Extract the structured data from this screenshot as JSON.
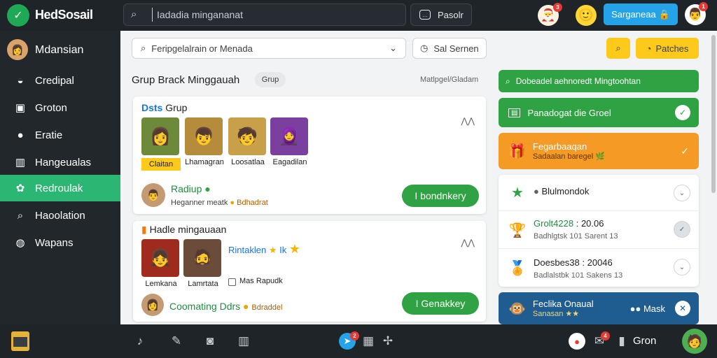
{
  "app": {
    "brand": "HedSosail"
  },
  "topbar": {
    "search_placeholder": "Iadadia mingananat",
    "button_label": "Pasolr",
    "primary_label": "Sarganeaa",
    "notif_count_1": "3",
    "notif_count_2": "1"
  },
  "sidebar": {
    "profile_name": "Mdansian",
    "items": [
      {
        "label": "Credipal",
        "icon": "chat-icon"
      },
      {
        "label": "Groton",
        "icon": "door-icon"
      },
      {
        "label": "Eratie",
        "icon": "user-icon"
      },
      {
        "label": "Hangeualas",
        "icon": "chart-icon"
      },
      {
        "label": "Redroulak",
        "icon": "leaf-icon",
        "active": true
      },
      {
        "label": "Haoolation",
        "icon": "search-icon"
      },
      {
        "label": "Wapans",
        "icon": "speech-icon"
      }
    ]
  },
  "main": {
    "search_value": "Feripgelalrain or Menada",
    "filter_label": "Sal Sernen",
    "patch_label": "Patches",
    "section_title": "Grup Brack Minggauah",
    "chip_label": "Grup",
    "meta_right": "Matlpgel/Gladam",
    "card1": {
      "title_accent": "Dsts",
      "title_rest": "Grup",
      "members": [
        {
          "name": "Claitan",
          "highlight": true
        },
        {
          "name": "Lhamagran"
        },
        {
          "name": "Loosatlaa"
        },
        {
          "name": "Eagadilan"
        }
      ],
      "row_title": "Radiup",
      "row_sub_prefix": "Heganner meatk",
      "row_sub_warn": "Bdhadrat",
      "button_label": "I bondnkery"
    },
    "card2": {
      "title": "Hadle mingauaan",
      "members": [
        {
          "name": "Lemkana"
        },
        {
          "name": "Lamrtata"
        }
      ],
      "tag": "Rintaklen",
      "tag_count": "Ik",
      "checkbox_label": "Mas Rapudk",
      "row_title": "Coomating Ddrs",
      "row_sub_warn": "Bdraddel",
      "button_label": "I Genakkey"
    }
  },
  "right_panel": {
    "banner1": "Dobeadel aehnoredt Mingtoohtan",
    "banner2": "Panadogat die Groel",
    "banner3_title": "Fegarbaaqan",
    "banner3_sub": "Sadaalan baregel",
    "list_header": "Blulmondok",
    "rows": [
      {
        "title_green": "Grolt4228",
        "title_rest": ": 20.06",
        "sub": "Badhlgtsk 101 Sarent 13"
      },
      {
        "title_green": "",
        "title_rest": "Doesbes38 : 20046",
        "sub": "Badlalstbk 101 Sakens 13"
      }
    ],
    "banner4_title": "Feclika Onaual",
    "banner4_sub": "Sanasan",
    "banner4_action": "Mask"
  },
  "bottombar": {
    "label": "Gron",
    "count_a": "2",
    "count_b": "4"
  },
  "colors": {
    "accent_green": "#2bb673",
    "button_green": "#2fa343",
    "primary_blue": "#25a3e8",
    "yellow": "#fdc91a",
    "orange_banner": "#f59b25",
    "navy_banner": "#1f5c8f"
  }
}
